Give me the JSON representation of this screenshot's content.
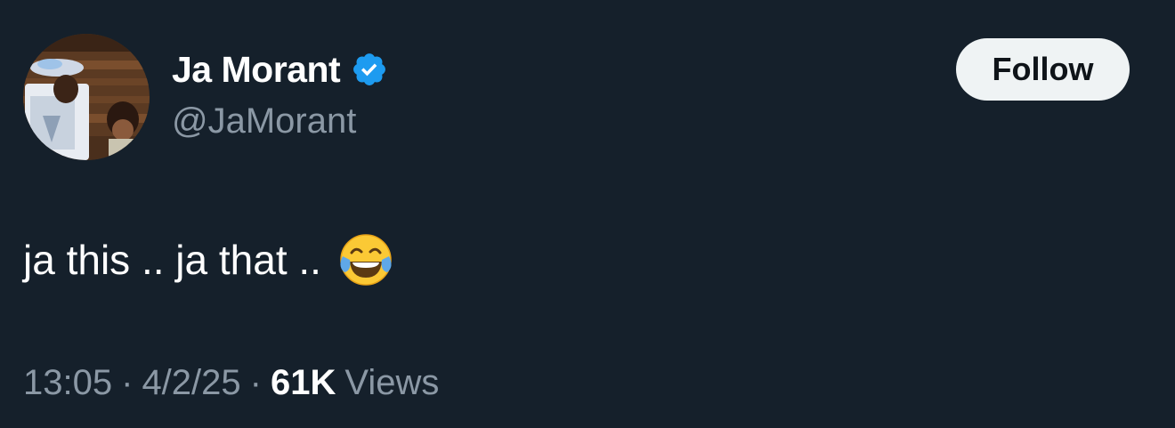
{
  "author": {
    "display_name": "Ja Morant",
    "handle": "@JaMorant",
    "verified_icon": "verified-badge-icon",
    "avatar_icon": "profile-photo"
  },
  "follow_button": {
    "label": "Follow"
  },
  "tweet": {
    "text": "ja this .. ja that ..",
    "emoji_icon": "face-with-tears-of-joy-emoji"
  },
  "meta": {
    "time": "13:05",
    "separator": "·",
    "date": "4/2/25",
    "views_count": "61K",
    "views_label": "Views"
  },
  "colors": {
    "background": "#15202b",
    "text_primary": "#ffffff",
    "text_secondary": "#8b98a5",
    "verified_blue": "#1d9bf0",
    "follow_bg": "#eff3f4",
    "follow_text": "#0f1419"
  }
}
